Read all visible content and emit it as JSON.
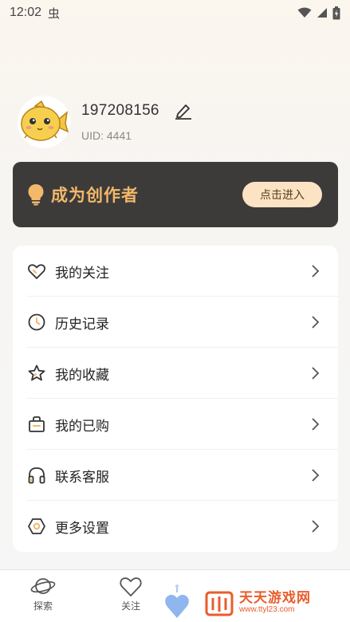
{
  "status_bar": {
    "time": "12:02",
    "app_icon": "虫",
    "icons": [
      "wifi-icon",
      "signal-icon",
      "battery-icon"
    ]
  },
  "profile": {
    "username": "197208156",
    "uid": "UID: 4441"
  },
  "creator_banner": {
    "title": "成为创作者",
    "button": "点击进入",
    "colors": {
      "background": "#3d3b3a",
      "title": "#f3b86a",
      "button_bg": "#fbe3c3"
    }
  },
  "menu": {
    "items": [
      {
        "label": "我的关注",
        "icon": "heart-icon"
      },
      {
        "label": "历史记录",
        "icon": "clock-icon"
      },
      {
        "label": "我的收藏",
        "icon": "star-icon"
      },
      {
        "label": "我的已购",
        "icon": "shopping-bag-icon"
      },
      {
        "label": "联系客服",
        "icon": "headphones-icon"
      },
      {
        "label": "更多设置",
        "icon": "settings-icon"
      }
    ]
  },
  "bottom_nav": {
    "items": [
      {
        "label": "探索",
        "icon": "planet-icon"
      },
      {
        "label": "关注",
        "icon": "heart-icon"
      }
    ]
  },
  "watermark": {
    "title": "天天游戏网",
    "url": "www.ttyl23.com"
  }
}
